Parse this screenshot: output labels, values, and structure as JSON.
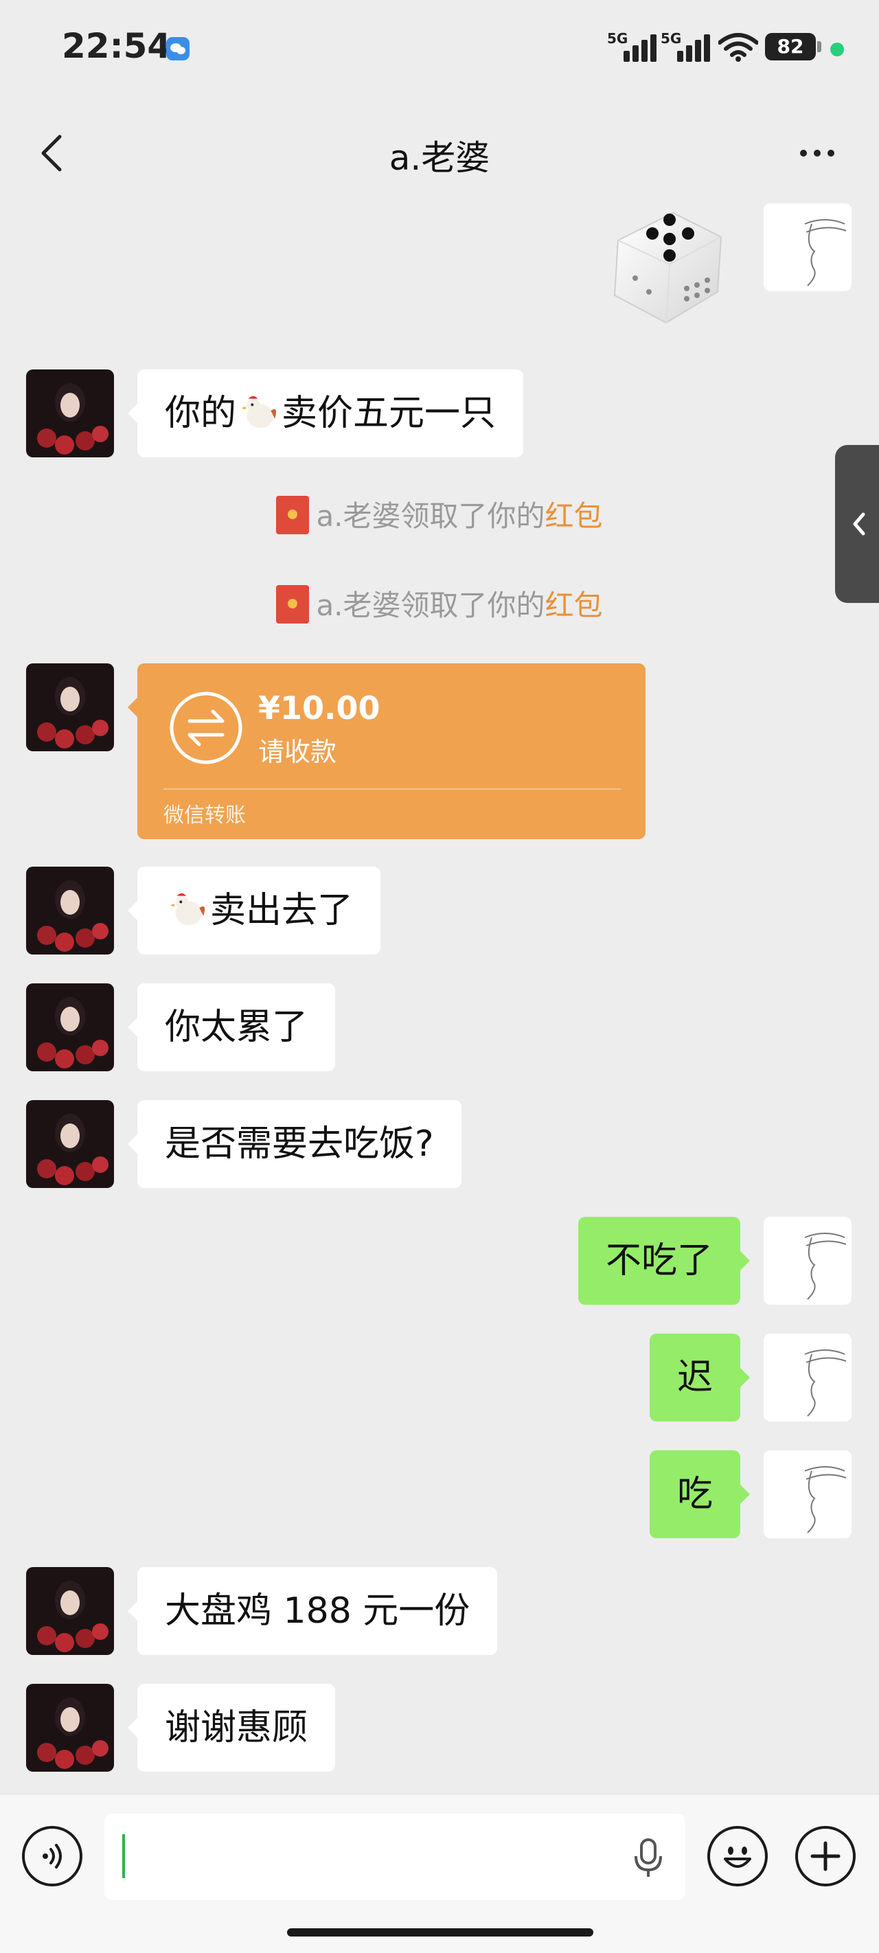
{
  "status_bar": {
    "time": "22:54",
    "signal_1_label": "5G",
    "signal_2_label": "5G",
    "battery": "82"
  },
  "header": {
    "title": "a.老婆"
  },
  "messages": {
    "m1": "你的",
    "m1_after": "卖价五元一只",
    "sys1_prefix": "a.老婆领取了你的",
    "sys1_link": "红包",
    "sys2_prefix": "a.老婆领取了你的",
    "sys2_link": "红包",
    "transfer_amount": "¥10.00",
    "transfer_label": "请收款",
    "transfer_footer": "微信转账",
    "m3_after": "卖出去了",
    "m4": "你太累了",
    "m5": "是否需要去吃饭?",
    "m6": "不吃了",
    "m7": "迟",
    "m8": "吃",
    "m9": "大盘鸡 188 元一份",
    "m10": "谢谢惠顾"
  },
  "input": {
    "value": ""
  },
  "colors": {
    "background": "#ededed",
    "sent_bubble": "#95ec69",
    "received_bubble": "#ffffff",
    "transfer_card": "#f0a24f",
    "link": "#e8913a"
  },
  "icons": [
    "back-chevron-icon",
    "more-dots-icon",
    "dice-icon",
    "red-packet-icon",
    "transfer-icon",
    "voice-icon",
    "microphone-icon",
    "emoji-icon",
    "plus-icon",
    "collapse-chevron-icon"
  ]
}
